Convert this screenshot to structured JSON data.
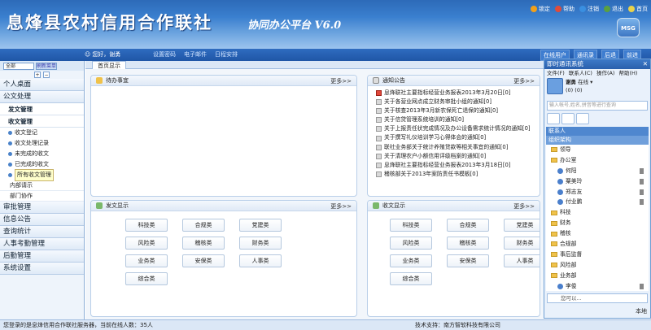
{
  "header": {
    "title": "息烽县农村信用合作联社",
    "subtitle": "协同办公平台 V6.0",
    "tools": [
      {
        "label": "锁定",
        "color": "#f2a019"
      },
      {
        "label": "帮助",
        "color": "#e04b3a"
      },
      {
        "label": "注销",
        "color": "#3a8fe0"
      },
      {
        "label": "退出",
        "color": "#5aa040"
      },
      {
        "label": "首页",
        "color": "#e9d24a"
      }
    ],
    "badge": "MSG"
  },
  "bar": {
    "greeting": "您好，谢勇",
    "links": [
      "设置密码",
      "电子邮件",
      "日程安排"
    ],
    "right": [
      "在线用户",
      "通讯录",
      "后退",
      "前进"
    ]
  },
  "sidebar": {
    "select": "全部",
    "refresh": "刷新菜单",
    "sections": [
      {
        "label": "个人桌面"
      },
      {
        "label": "公文处理"
      }
    ],
    "subs": [
      {
        "label": "发文管理"
      },
      {
        "label": "收文管理"
      }
    ],
    "leaves": [
      {
        "label": "收文登记"
      },
      {
        "label": "收文处理记录"
      },
      {
        "label": "未完成的收文"
      },
      {
        "label": "已完成的收文"
      },
      {
        "label": "所有收文管理"
      }
    ],
    "plains": [
      {
        "label": "内部请示"
      },
      {
        "label": "部门协作"
      }
    ],
    "more": [
      {
        "label": "审批管理"
      },
      {
        "label": "信息公告"
      },
      {
        "label": "查询统计"
      },
      {
        "label": "人事考勤管理"
      },
      {
        "label": "后勤管理"
      },
      {
        "label": "系统设置"
      }
    ]
  },
  "main": {
    "tab": "首页显示",
    "todo": {
      "title": "待办事宜",
      "more": "更多>>"
    },
    "notice": {
      "title": "通知公告",
      "more": "更多>>",
      "items": [
        {
          "text": "息烽联社主要指标经营业务报表2013年3月20日[0]",
          "new": true
        },
        {
          "text": "关于各营业网点成立财务审批小组的通知[0]",
          "new": false
        },
        {
          "text": "关于核查2013年3月新农保死亡退保的通知[0]",
          "new": false
        },
        {
          "text": "关于信贷管理系统培训的通知[0]",
          "new": false
        },
        {
          "text": "关于上报责任状完成情况及办公设备需求统计情况的通知[0]",
          "new": false
        },
        {
          "text": "关于撰写礼仪培训学习心得体会的通知[0]",
          "new": false
        },
        {
          "text": "联社业务部关于统计养殖贷款等相关事宜的通知[0]",
          "new": false
        },
        {
          "text": "关于清理农户小额信用评级档案的通知[0]",
          "new": false
        },
        {
          "text": "息烽联社主要指标经营业务报表2013年3月18日[0]",
          "new": false
        },
        {
          "text": "稽核部关于2013年案防责任书模板[0]",
          "new": false
        }
      ]
    },
    "send": {
      "title": "发文显示",
      "more": "更多>>",
      "items": [
        "科技类",
        "合规类",
        "党建类",
        "风险类",
        "稽核类",
        "财务类",
        "业务类",
        "安保类",
        "人事类",
        "综合类"
      ]
    },
    "recv": {
      "title": "收文显示",
      "more": "更多>>",
      "items": [
        "科技类",
        "合规类",
        "党建类",
        "风险类",
        "稽核类",
        "财务类",
        "业务类",
        "安保类",
        "人事类",
        "综合类"
      ]
    }
  },
  "im": {
    "title": "即时通讯系统",
    "menu": [
      "文件(F)",
      "联系人(C)",
      "操作(A)",
      "帮助(H)"
    ],
    "user": "谢勇",
    "status": "在线",
    "count1": "(0)",
    "count2": "(0)",
    "search_placeholder": "输入帐号,姓名,拼音等进行查询",
    "contacts": "联系人",
    "org": "组织架构",
    "tree": [
      {
        "label": "领导",
        "kind": "folder"
      },
      {
        "label": "办公室",
        "kind": "folder"
      },
      {
        "label": "何阳",
        "kind": "person"
      },
      {
        "label": "粟美玲",
        "kind": "person"
      },
      {
        "label": "郑志友",
        "kind": "person"
      },
      {
        "label": "付业鹏",
        "kind": "person"
      },
      {
        "label": "科技",
        "kind": "folder"
      },
      {
        "label": "财务",
        "kind": "folder"
      },
      {
        "label": "稽核",
        "kind": "folder"
      },
      {
        "label": "合规部",
        "kind": "folder"
      },
      {
        "label": "事后监督",
        "kind": "folder"
      },
      {
        "label": "风险部",
        "kind": "folder"
      },
      {
        "label": "业务部",
        "kind": "folder"
      },
      {
        "label": "李俊",
        "kind": "person"
      }
    ],
    "input_placeholder": "您可以...",
    "local": "本地"
  },
  "status": {
    "left": "您登录的是息烽信用合作联社服务器，当前在线人数：35人",
    "right": "技术支持：南方智软科技有限公司"
  }
}
